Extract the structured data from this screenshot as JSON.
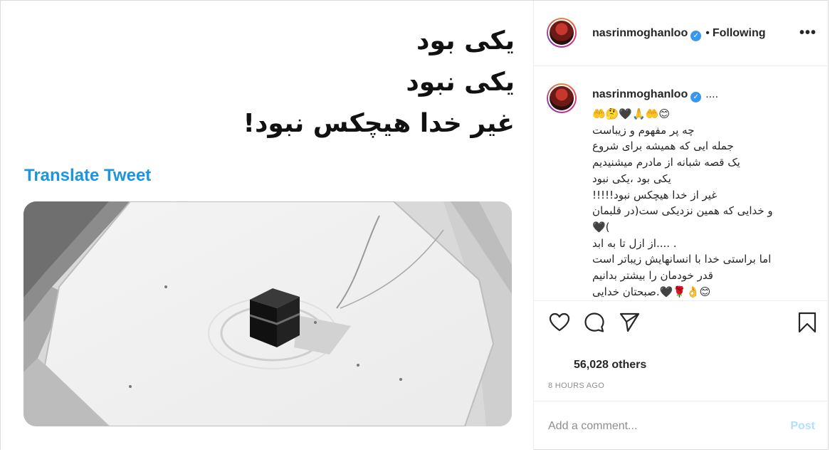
{
  "media": {
    "tweet_lines": [
      "یکی بود",
      "یکی نبود",
      "غیر خدا هیچکس نبود!"
    ],
    "translate_label": "Translate Tweet"
  },
  "header": {
    "username": "nasrinmoghanloo",
    "separator": "•",
    "following_label": "Following",
    "more_label": "•••"
  },
  "caption": {
    "username": "nasrinmoghanloo",
    "after_name": "....",
    "lines": [
      "🤲🤔🖤🙏🤲😊",
      "چه پر مفهوم و زیباست",
      "جمله ایی که همیشه برای شروع",
      "یک قصه شبانه از مادرم میشنیدیم",
      "یکی بود ،یکی نبود",
      "غیر از خدا هیچکس نبود!!!!!",
      "و خدایی که همین نزدیکی ست(در قلبمان",
      "🖤(",
      ". ....از ازل تا به ابد",
      "اما براستی خدا با انسانهایش زیباتر است",
      "قدر خودمان را بیشتر بدانیم",
      "😊👌🌹🖤.صبحتان خدایی"
    ]
  },
  "likes_text": "56,028 others",
  "timestamp": "8 HOURS AGO",
  "comment": {
    "placeholder": "Add a comment...",
    "post_label": "Post"
  },
  "colors": {
    "link_blue": "#1b95e0",
    "verified_blue": "#3897f0",
    "post_disabled": "#b2dffc",
    "muted_text": "#8e8e8e",
    "border": "#efefef"
  },
  "icons": [
    "verified-badge-icon",
    "more-options-icon",
    "heart-icon",
    "comment-icon",
    "share-icon",
    "bookmark-icon"
  ]
}
